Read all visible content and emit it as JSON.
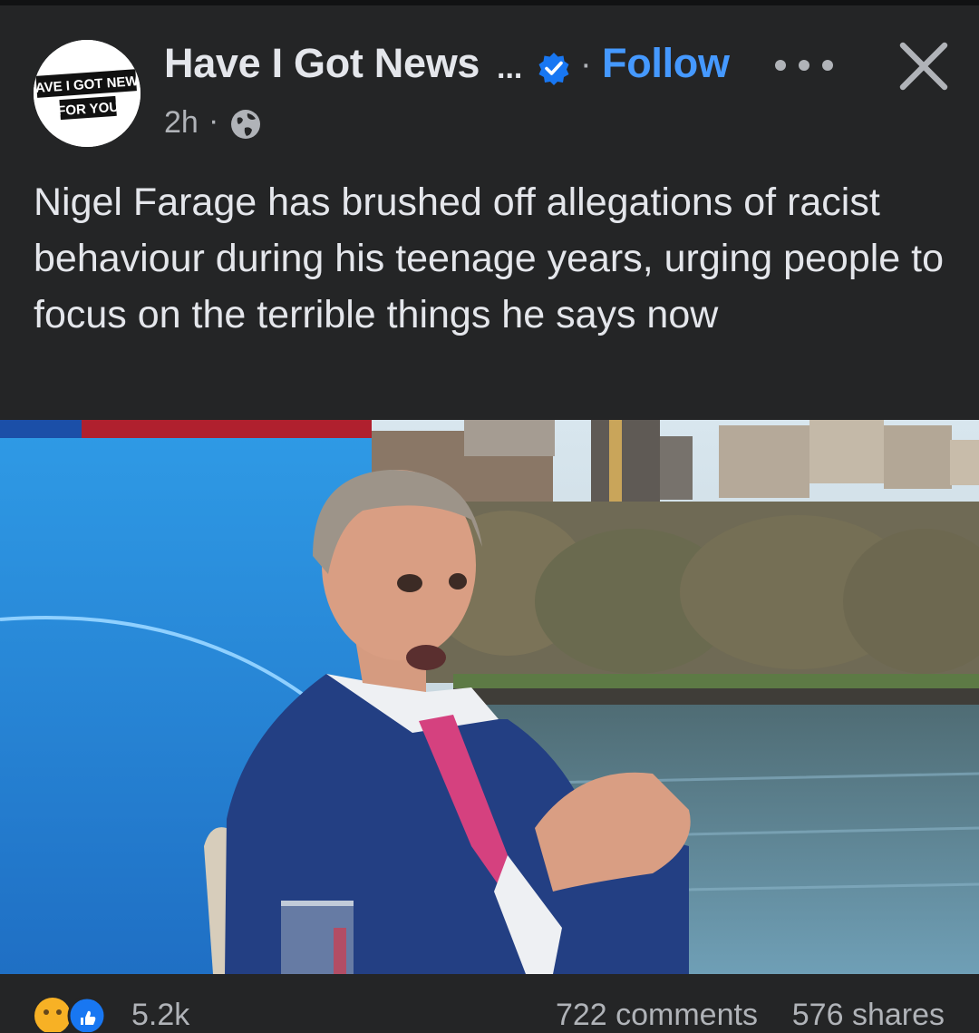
{
  "post": {
    "page_name": "Have I Got News",
    "truncation": "...",
    "separator": "·",
    "follow_label": "Follow",
    "time": "2h",
    "time_separator": "·",
    "text": "Nigel Farage has brushed off allegations of racist behaviour during his teenage years, urging people to focus on the terrible things he says now",
    "avatar_logo_text": [
      "HAVE I GOT NEWS",
      "FOR YOU"
    ],
    "icons": {
      "verified": "verified-badge-icon",
      "more": "more-options-icon",
      "close": "close-icon",
      "privacy": "globe-icon"
    }
  },
  "footer": {
    "reaction_count": "5.2k",
    "comments": "722 comments",
    "shares": "576 shares"
  },
  "colors": {
    "background": "#242526",
    "text": "#e4e6eb",
    "secondary_text": "#b0b3b8",
    "accent": "#4599ff"
  }
}
